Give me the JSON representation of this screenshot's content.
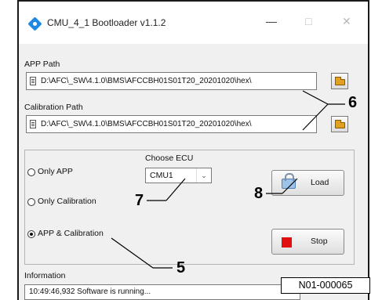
{
  "window": {
    "title": "CMU_4_1 Bootloader v1.1.2",
    "minimize": "—",
    "maximize": "□",
    "close": "✕"
  },
  "app_path": {
    "label": "APP Path",
    "value": "D:\\AFC\\_SW\\4.1.0\\BMS\\AFCCBH01S01T20_20201020\\hex\\"
  },
  "calibration_path": {
    "label": "Calibration Path",
    "value": "D:\\AFC\\_SW\\4.1.0\\BMS\\AFCCBH01S01T20_20201020\\hex\\"
  },
  "mode_options": [
    {
      "label": "Only APP",
      "selected": false
    },
    {
      "label": "Only Calibration",
      "selected": false
    },
    {
      "label": "APP & Calibration",
      "selected": true
    }
  ],
  "ecu": {
    "label": "Choose ECU",
    "value": "CMU1"
  },
  "buttons": {
    "load": "Load",
    "stop": "Stop"
  },
  "information": {
    "label": "Information",
    "log": "10:49:46,932 Software is running..."
  },
  "callouts": {
    "paths": "6",
    "ecu": "7",
    "load": "8",
    "mode": "5"
  },
  "reference": "N01-000065",
  "icons": [
    "app-diamond-icon",
    "file-icon",
    "folder-icon",
    "lock-icon",
    "stop-icon",
    "chevron-down-icon"
  ]
}
